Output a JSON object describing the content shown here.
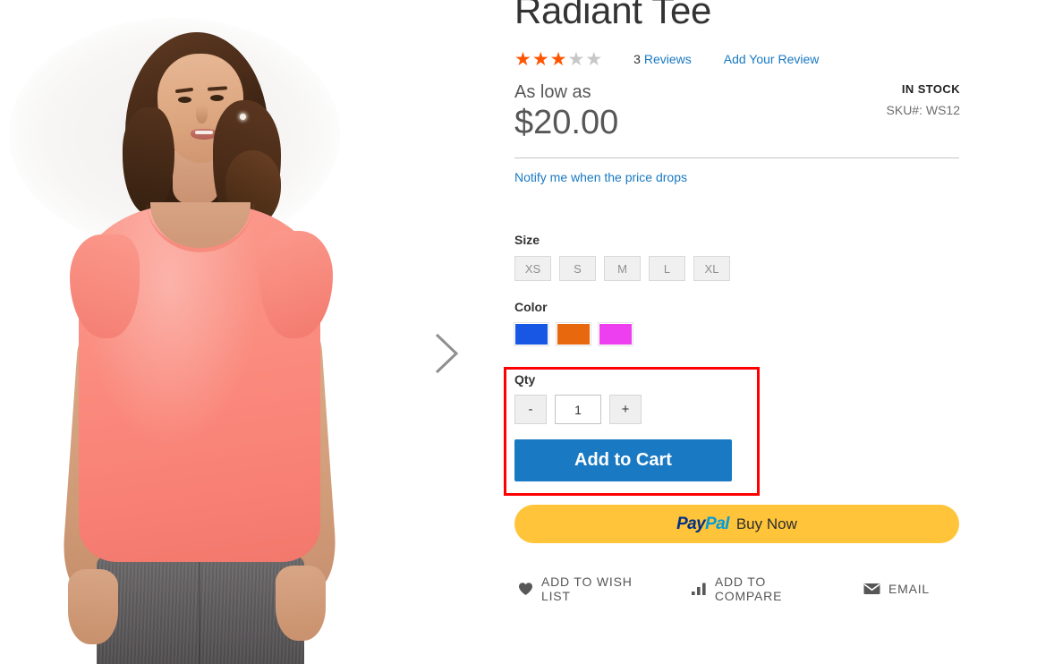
{
  "product": {
    "title": "Radiant Tee",
    "rating": {
      "filled": 3,
      "total": 5,
      "reviews_count": "3",
      "reviews_label": "Reviews",
      "add_review_label": "Add Your Review"
    },
    "price": {
      "as_low_as_label": "As low as",
      "value": "$20.00"
    },
    "availability": {
      "status": "IN STOCK",
      "sku_label": "SKU#:",
      "sku_value": "WS12"
    },
    "notify_label": "Notify me when the price drops",
    "size": {
      "label": "Size",
      "options": [
        {
          "label": "XS"
        },
        {
          "label": "S"
        },
        {
          "label": "M"
        },
        {
          "label": "L"
        },
        {
          "label": "XL"
        }
      ]
    },
    "color": {
      "label": "Color",
      "options": [
        {
          "name": "blue",
          "hex": "#1757e4"
        },
        {
          "name": "orange",
          "hex": "#e8680d"
        },
        {
          "name": "purple",
          "hex": "#ed3ff0"
        }
      ]
    },
    "qty": {
      "label": "Qty",
      "decrement_label": "-",
      "increment_label": "+",
      "value": "1"
    },
    "add_to_cart_label": "Add to Cart",
    "paypal": {
      "pay": "Pay",
      "pal": "Pal",
      "action_label": "Buy Now"
    },
    "actions": [
      {
        "icon": "heart-icon",
        "label": "ADD TO WISH LIST"
      },
      {
        "icon": "bar-chart-icon",
        "label": "ADD TO COMPARE"
      },
      {
        "icon": "envelope-icon",
        "label": "EMAIL"
      }
    ]
  },
  "gallery": {
    "next_arrow": "chevron-right-icon"
  },
  "annotation": {
    "highlight_color": "#fe0000"
  }
}
